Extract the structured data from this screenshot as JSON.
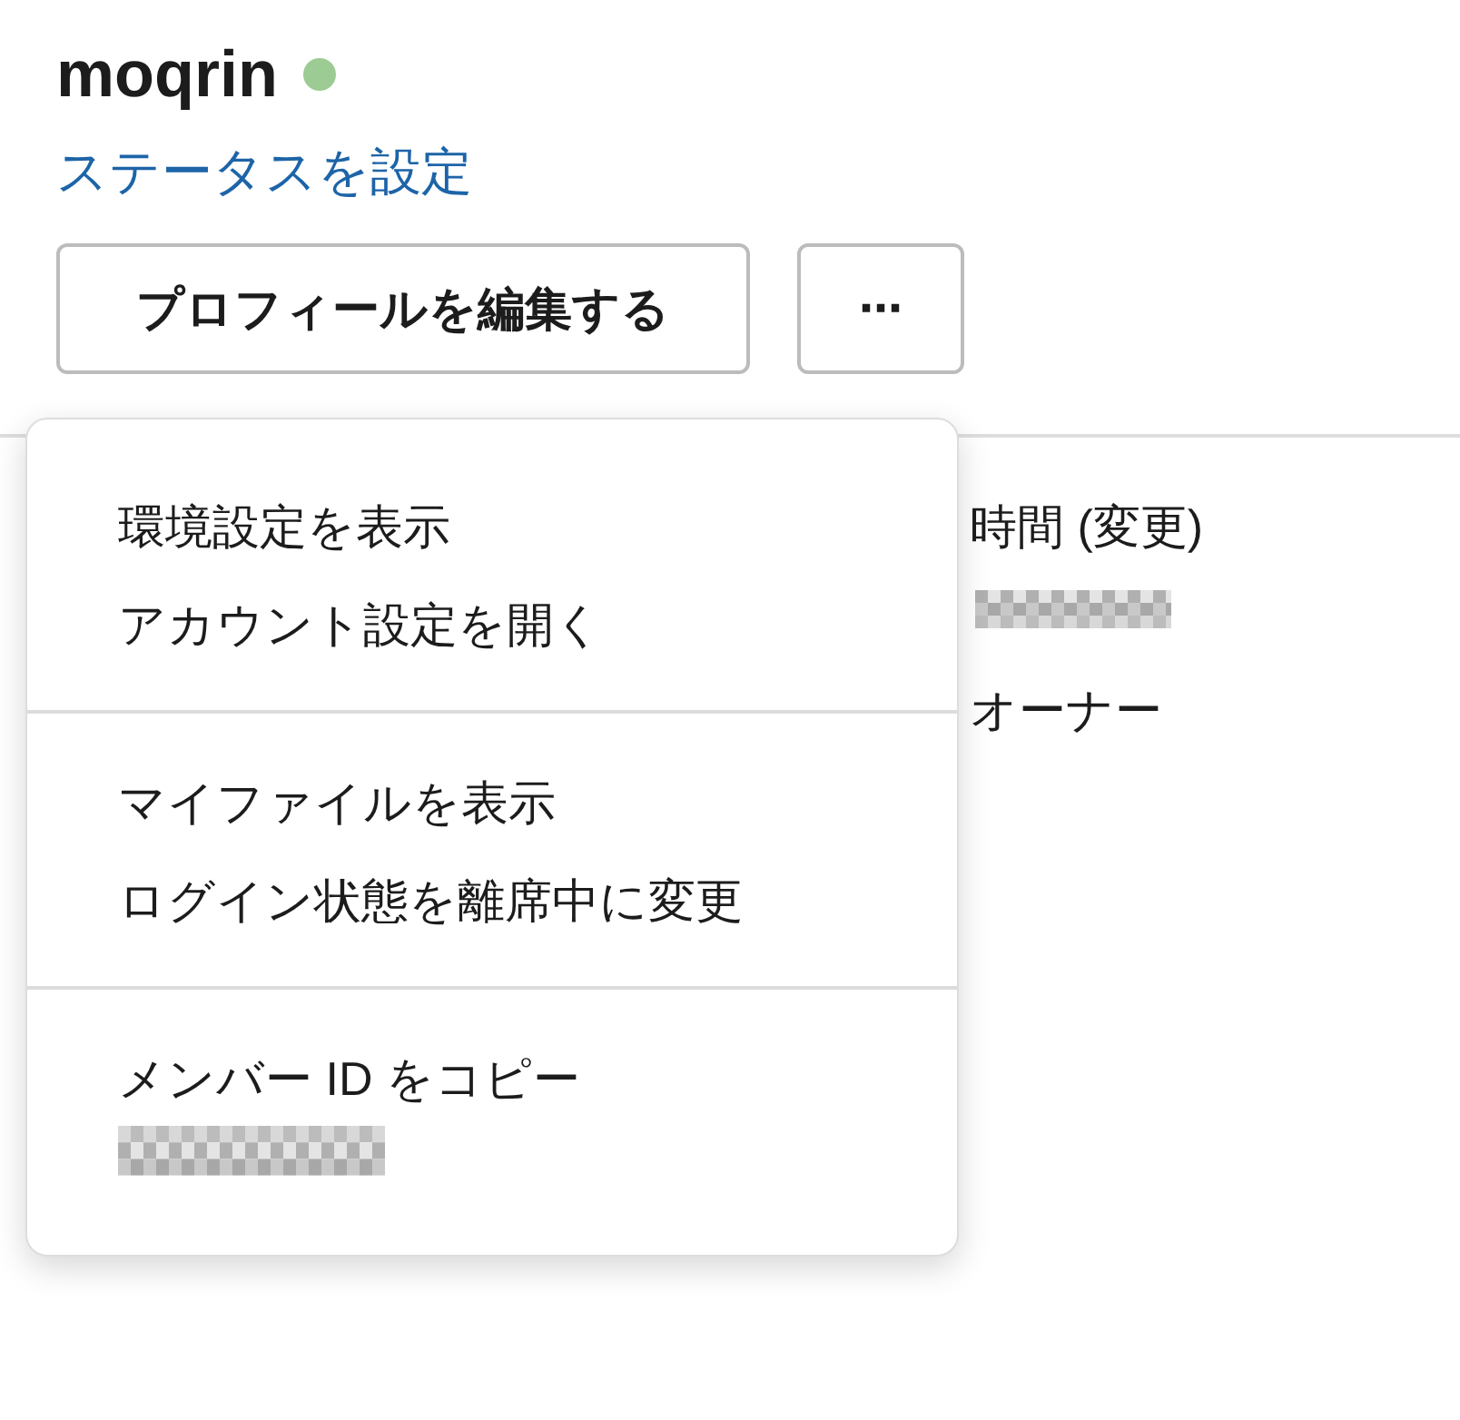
{
  "profile": {
    "name": "moqrin",
    "online": true,
    "status_link": "ステータスを設定"
  },
  "buttons": {
    "edit": "プロフィールを編集する",
    "more": "⋯"
  },
  "details": [
    {
      "kind": "text",
      "text": "時間 (変更)"
    },
    {
      "kind": "redacted"
    },
    {
      "kind": "text",
      "text": "オーナー"
    }
  ],
  "menu": {
    "groups": [
      [
        {
          "kind": "action",
          "label": "環境設定を表示"
        },
        {
          "kind": "action",
          "label": "アカウント設定を開く"
        }
      ],
      [
        {
          "kind": "action",
          "label": "マイファイルを表示"
        },
        {
          "kind": "action",
          "label": "ログイン状態を離席中に変更"
        }
      ],
      [
        {
          "kind": "copy_id",
          "label": "メンバー ID をコピー"
        }
      ]
    ]
  }
}
